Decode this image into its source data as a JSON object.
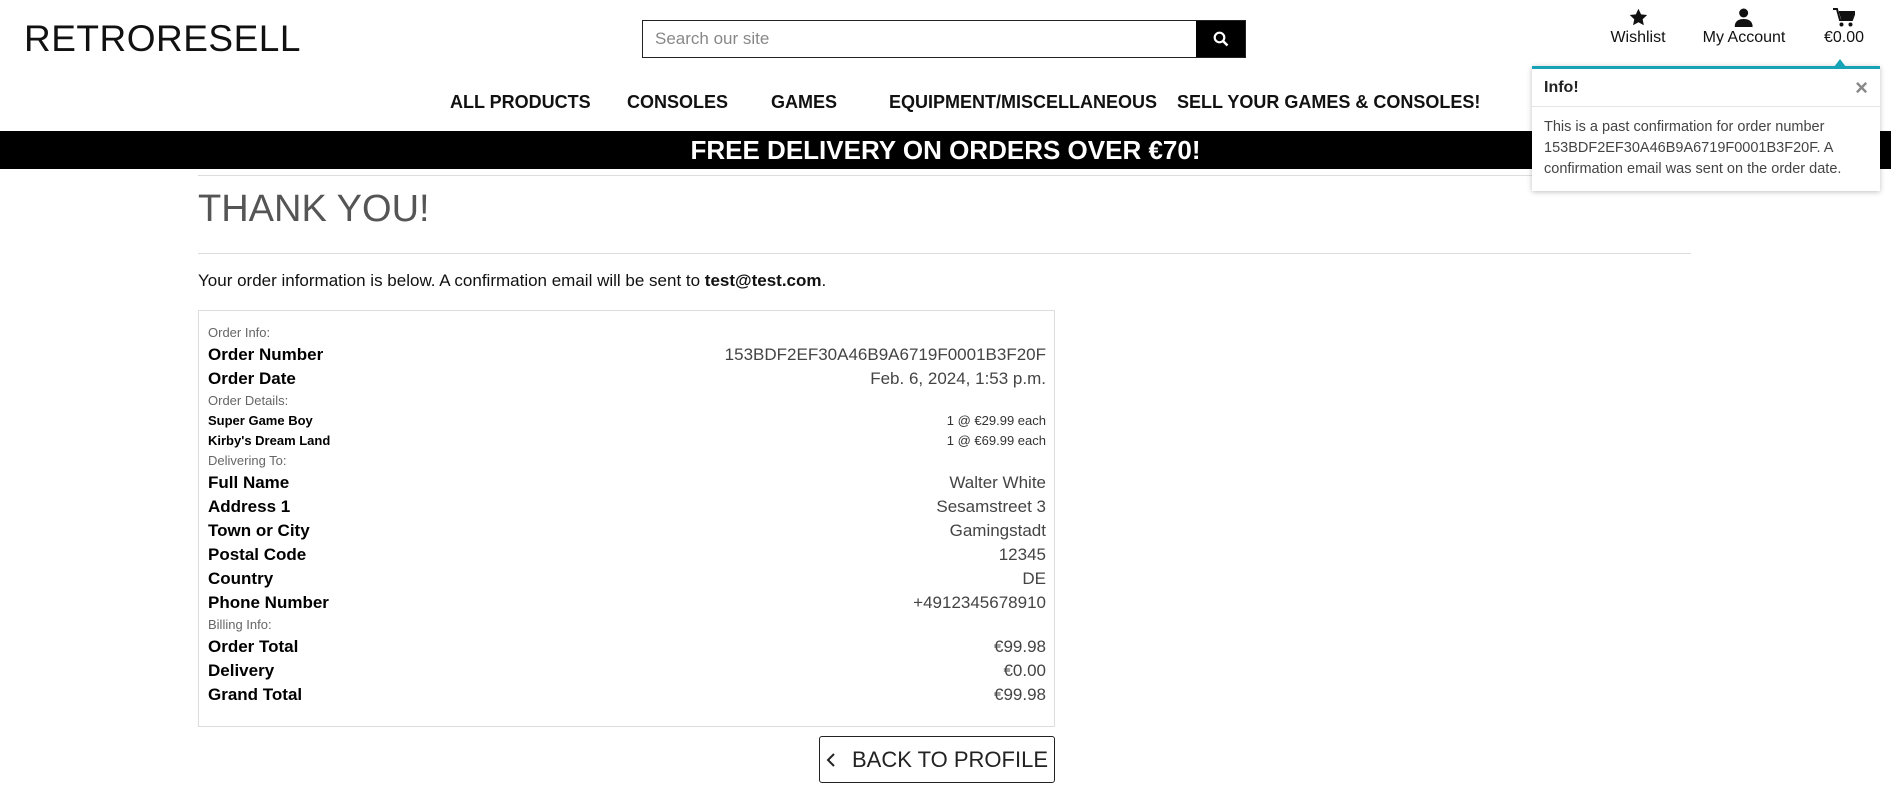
{
  "header": {
    "logo": "RETRORESELL",
    "search_placeholder": "Search our site",
    "wishlist": "Wishlist",
    "account": "My Account",
    "cart_total": "€0.00"
  },
  "nav": [
    "ALL PRODUCTS",
    "CONSOLES",
    "GAMES",
    "EQUIPMENT/MISCELLANEOUS",
    "SELL YOUR GAMES & CONSOLES!"
  ],
  "banner": "FREE DELIVERY ON ORDERS OVER €70!",
  "toast": {
    "title": "Info!",
    "close": "×",
    "message": "This is a past confirmation for order number 153BDF2EF30A46B9A6719F0001B3F20F. A confirmation email was sent on the order date.",
    "accent": "#17a2b8"
  },
  "page": {
    "title": "THANK YOU!",
    "intro_prefix": "Your order information is below. A confirmation email will be sent to ",
    "email": "test@test.com",
    "intro_suffix": "."
  },
  "order": {
    "order_info_label": "Order Info:",
    "order_info": [
      {
        "k": "Order Number",
        "v": "153BDF2EF30A46B9A6719F0001B3F20F"
      },
      {
        "k": "Order Date",
        "v": "Feb. 6, 2024, 1:53 p.m."
      }
    ],
    "details_label": "Order Details:",
    "items": [
      {
        "k": "Super Game Boy",
        "v": "1 @ €29.99 each"
      },
      {
        "k": "Kirby's Dream Land",
        "v": "1 @ €69.99 each"
      }
    ],
    "delivery_label": "Delivering To:",
    "delivery": [
      {
        "k": "Full Name",
        "v": "Walter White"
      },
      {
        "k": "Address 1",
        "v": "Sesamstreet 3"
      },
      {
        "k": "Town or City",
        "v": "Gamingstadt"
      },
      {
        "k": "Postal Code",
        "v": "12345"
      },
      {
        "k": "Country",
        "v": "DE"
      },
      {
        "k": "Phone Number",
        "v": "+4912345678910"
      }
    ],
    "billing_label": "Billing Info:",
    "billing": [
      {
        "k": "Order Total",
        "v": "€99.98"
      },
      {
        "k": "Delivery",
        "v": "€0.00"
      },
      {
        "k": "Grand Total",
        "v": "€99.98"
      }
    ]
  },
  "back_button": "BACK TO PROFILE"
}
